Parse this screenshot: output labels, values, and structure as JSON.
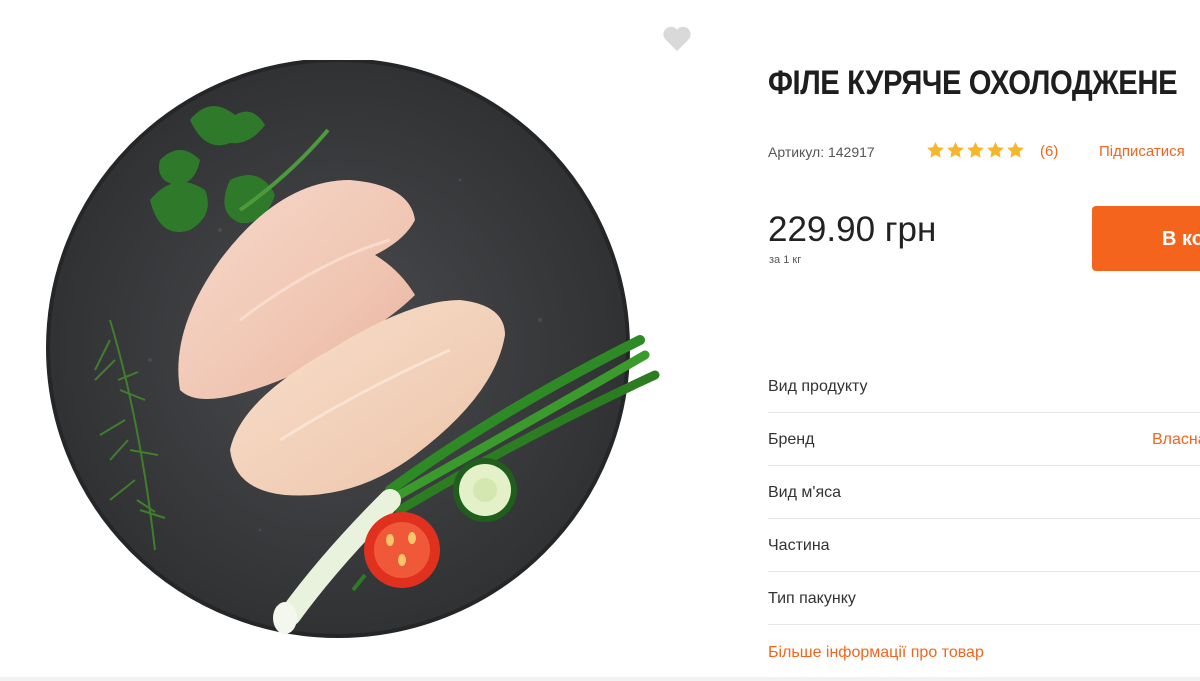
{
  "product": {
    "title": "ФІЛЕ КУРЯЧЕ ОХОЛОДЖЕНЕ",
    "sku_label": "Артикул: 142917",
    "rating_count": "(6)",
    "subscribe": "Підписатися",
    "price": "229.90 грн",
    "price_unit": "за 1 кг",
    "add_to_cart": "В кошик",
    "image_alt": "chicken-fillet-photo"
  },
  "rating": {
    "stars": 5,
    "max": 5
  },
  "specs": [
    {
      "key": "Вид продукту",
      "value": ""
    },
    {
      "key": "Бренд",
      "value": "Власна"
    },
    {
      "key": "Вид м'яса",
      "value": ""
    },
    {
      "key": "Частина",
      "value": ""
    },
    {
      "key": "Тип пакунку",
      "value": ""
    }
  ],
  "more_info": "Більше інформації про товар",
  "colors": {
    "accent": "#f4641d",
    "star": "#f7b52c",
    "heart": "#d9d9d9",
    "slate": "#3a3b3d"
  },
  "icons": {
    "favorite": "heart-icon",
    "rating": "star-icon"
  }
}
